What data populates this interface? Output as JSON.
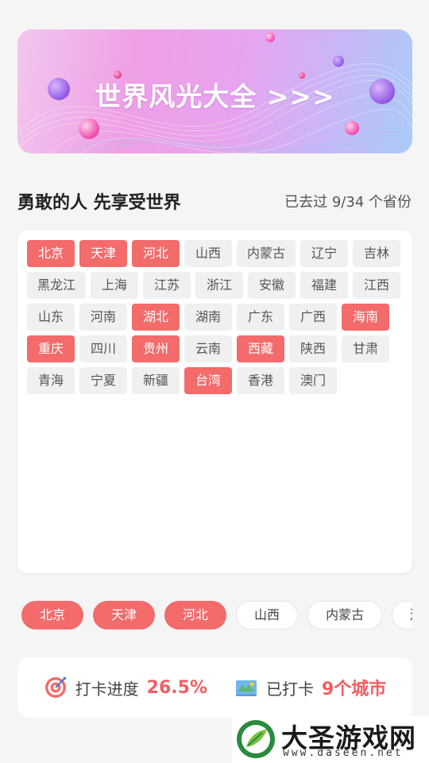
{
  "banner": {
    "title": "世界风光大全 >>>"
  },
  "section": {
    "title": "勇敢的人 先享受世界",
    "count": "已去过 9/34 个省份"
  },
  "provinces": [
    {
      "name": "北京",
      "visited": true
    },
    {
      "name": "天津",
      "visited": true
    },
    {
      "name": "河北",
      "visited": true
    },
    {
      "name": "山西",
      "visited": false
    },
    {
      "name": "内蒙古",
      "visited": false
    },
    {
      "name": "辽宁",
      "visited": false
    },
    {
      "name": "吉林",
      "visited": false
    },
    {
      "name": "黑龙江",
      "visited": false
    },
    {
      "name": "上海",
      "visited": false
    },
    {
      "name": "江苏",
      "visited": false
    },
    {
      "name": "浙江",
      "visited": false
    },
    {
      "name": "安徽",
      "visited": false
    },
    {
      "name": "福建",
      "visited": false
    },
    {
      "name": "江西",
      "visited": false
    },
    {
      "name": "山东",
      "visited": false
    },
    {
      "name": "河南",
      "visited": false
    },
    {
      "name": "湖北",
      "visited": true
    },
    {
      "name": "湖南",
      "visited": false
    },
    {
      "name": "广东",
      "visited": false
    },
    {
      "name": "广西",
      "visited": false
    },
    {
      "name": "海南",
      "visited": true
    },
    {
      "name": "重庆",
      "visited": true
    },
    {
      "name": "四川",
      "visited": false
    },
    {
      "name": "贵州",
      "visited": true
    },
    {
      "name": "云南",
      "visited": false
    },
    {
      "name": "西藏",
      "visited": true
    },
    {
      "name": "陕西",
      "visited": false
    },
    {
      "name": "甘肃",
      "visited": false
    },
    {
      "name": "青海",
      "visited": false
    },
    {
      "name": "宁夏",
      "visited": false
    },
    {
      "name": "新疆",
      "visited": false
    },
    {
      "name": "台湾",
      "visited": true
    },
    {
      "name": "香港",
      "visited": false
    },
    {
      "name": "澳门",
      "visited": false
    }
  ],
  "pills": [
    {
      "name": "北京",
      "active": true
    },
    {
      "name": "天津",
      "active": true
    },
    {
      "name": "河北",
      "active": true
    },
    {
      "name": "山西",
      "active": false
    },
    {
      "name": "内蒙古",
      "active": false
    },
    {
      "name": "辽宁",
      "active": false
    }
  ],
  "stats": {
    "progress_label": "打卡进度",
    "progress_value": "26.5%",
    "checkin_label": "已打卡",
    "checkin_value": "9个城市",
    "progress_icon": "target-icon",
    "checkin_icon": "map-icon"
  },
  "watermark": {
    "name": "大圣游戏网",
    "url": "www.daseen.net"
  },
  "colors": {
    "accent": "#f36b6b",
    "chip_bg": "#f0f0f0",
    "value": "#ef5f63"
  }
}
